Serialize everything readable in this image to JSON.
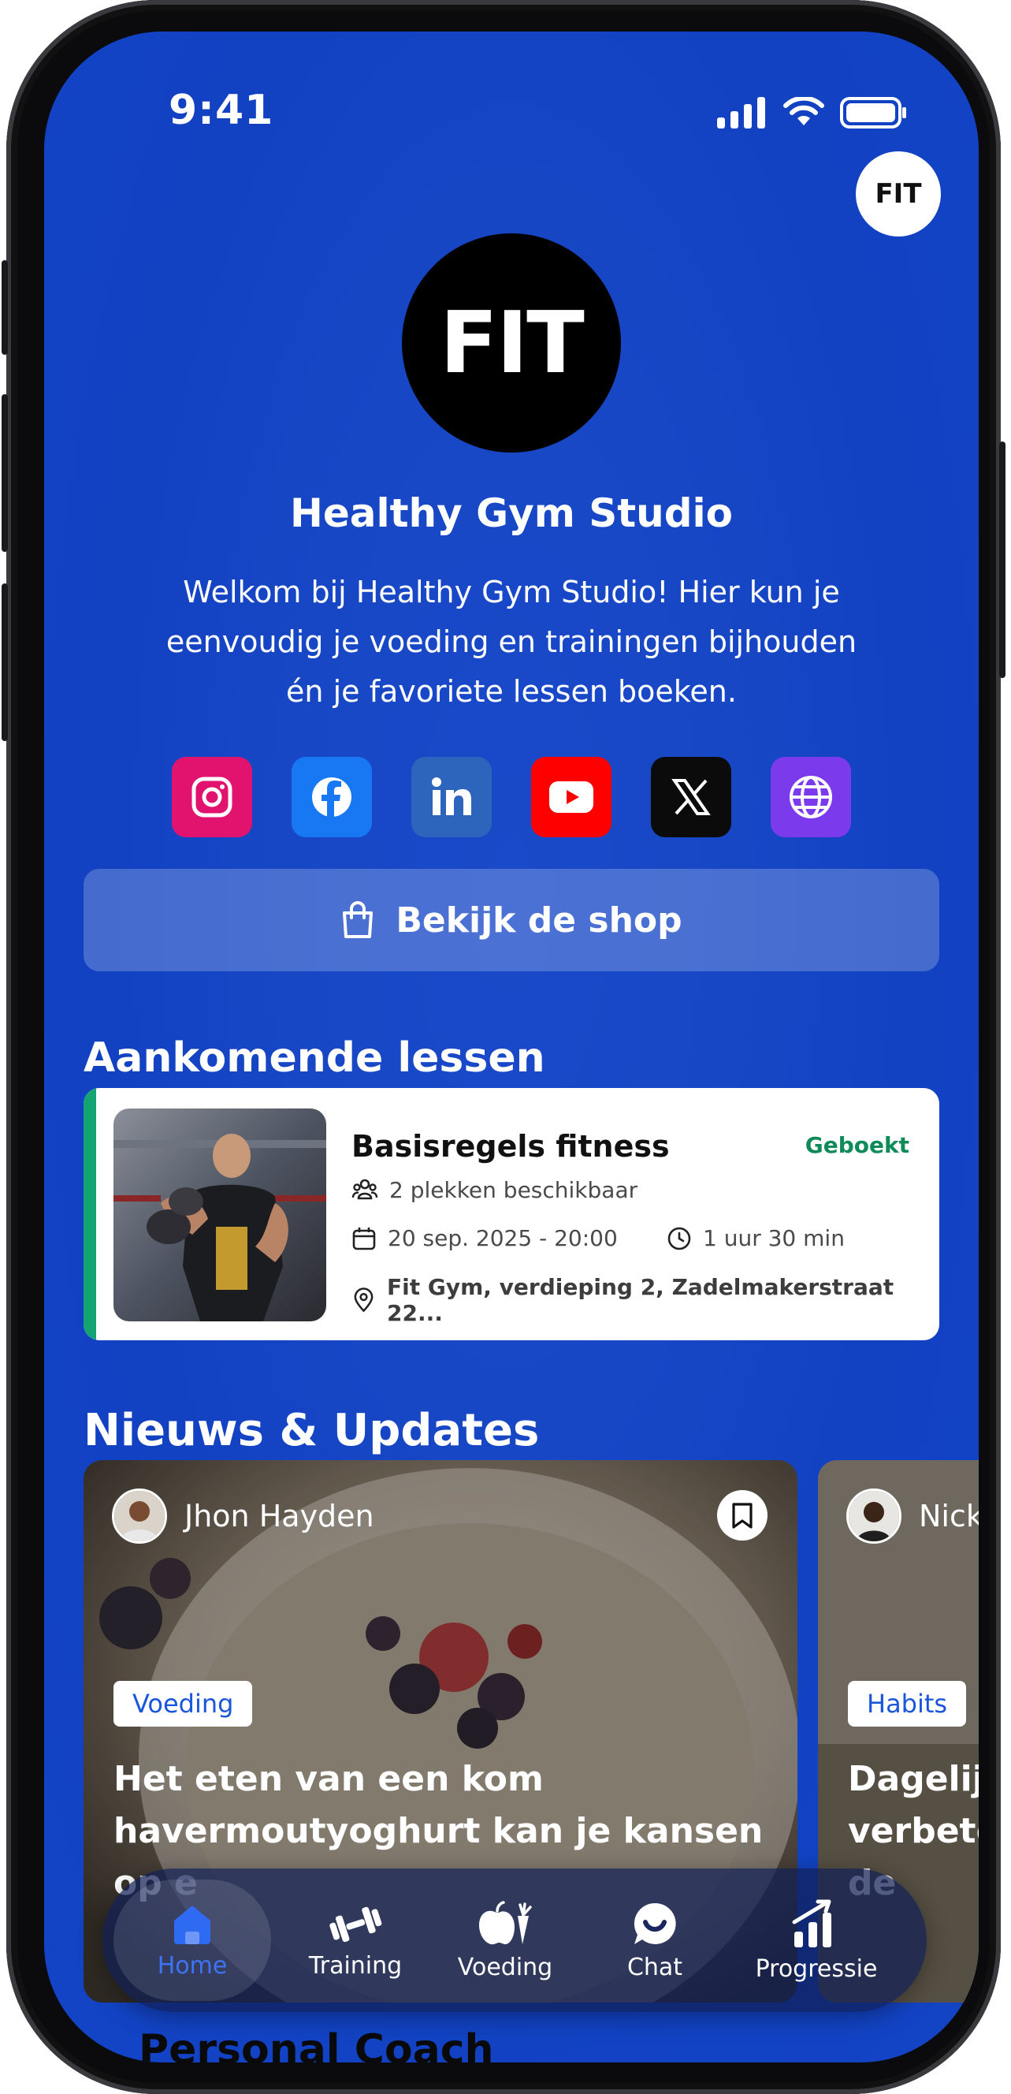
{
  "status": {
    "time": "9:41"
  },
  "studio": {
    "avatar_text": "FIT",
    "logo_text": "FIT",
    "name": "Healthy Gym Studio",
    "description": "Welkom bij Healthy Gym Studio! Hier kun je eenvoudig je voeding en trainingen bijhouden én je favoriete lessen boeken."
  },
  "socials": [
    {
      "icon": "instagram-icon",
      "color": "#e1136f"
    },
    {
      "icon": "facebook-icon",
      "color": "#1877f2"
    },
    {
      "icon": "linkedin-icon",
      "color": "#2d64bc"
    },
    {
      "icon": "youtube-icon",
      "color": "#ff0000"
    },
    {
      "icon": "x-icon",
      "color": "#0b0b0b"
    },
    {
      "icon": "globe-icon",
      "color": "#7c3aed"
    }
  ],
  "shop": {
    "label": "Bekijk de shop"
  },
  "lessons": {
    "heading": "Aankomende lessen",
    "items": [
      {
        "title": "Basisregels fitness",
        "status": "Geboekt",
        "spots": "2 plekken beschikbaar",
        "date": "20 sep. 2025 - 20:00",
        "duration": "1 uur 30 min",
        "location": "Fit Gym, verdieping 2, Zadelmakerstraat 22..."
      }
    ]
  },
  "news": {
    "heading": "Nieuws & Updates",
    "items": [
      {
        "author": "Jhon Hayden",
        "tag": "Voeding",
        "title": "Het eten van een kom havermoutyoghurt kan je kansen op e"
      },
      {
        "author": "Nick",
        "tag": "Habits",
        "title": "Dagelijl verbete n de"
      }
    ]
  },
  "tabbar": {
    "items": [
      {
        "label": "Home",
        "icon": "home-icon",
        "active": true
      },
      {
        "label": "Training",
        "icon": "dumbbell-icon",
        "active": false
      },
      {
        "label": "Voeding",
        "icon": "apple-carrot-icon",
        "active": false
      },
      {
        "label": "Chat",
        "icon": "chat-icon",
        "active": false
      },
      {
        "label": "Progressie",
        "icon": "progress-chart-icon",
        "active": false
      }
    ]
  },
  "next_section": {
    "heading_partial": "Personal Coach"
  },
  "colors": {
    "background": "#1446c6",
    "accent": "#1a56db",
    "booked": "#0f8a59"
  }
}
